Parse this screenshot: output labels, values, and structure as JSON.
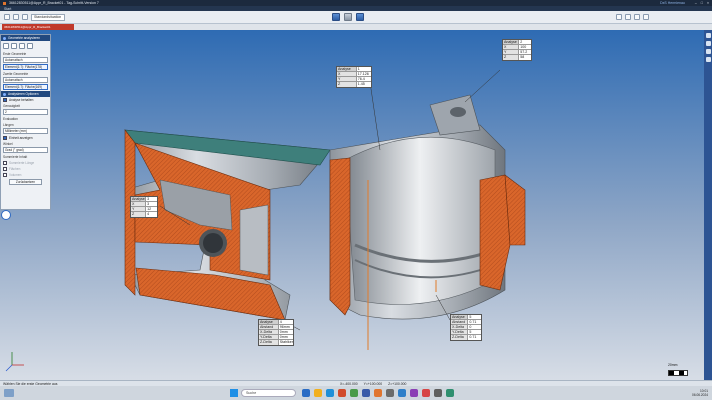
{
  "window": {
    "title": "36612830511@Appr_R_Bracket01 - Tag-Schritt-Version 7",
    "user": "DxS Hermienau",
    "controls": [
      "–",
      "□",
      "×"
    ]
  },
  "menu": {
    "label": "Start"
  },
  "toolbar": {
    "search_dropdown": "Standardsituation"
  },
  "document_tab": {
    "label": "36612830511@Appr_R_Bracket01"
  },
  "panel": {
    "header1": "Geometrie analysieren",
    "first_geometry_label": "Erste Geometrie",
    "first_geometry_mode": "Automatisch",
    "first_geometry_value": "Element(1:7): Fläche(178)",
    "second_geometry_label": "Zweite Geometrie",
    "second_geometry_mode": "Automatisch",
    "second_geometry_value": "Element(1:7): Fläche(169)",
    "header2": "Analysieren Optionen",
    "keep_analysis": "Analyse behalten",
    "precision_label": "Genauigkeit",
    "precision_value": "2",
    "evaluation_label": "Evaluation",
    "length_label": "Längen",
    "length_value": "Millimeter (mm)",
    "show_unit": "Einheit anzeigen",
    "angle_label": "Winkel",
    "angle_value": "Grad (° grad)",
    "sum_label": "Summierte Inhalt",
    "sum_length": "Summierte Länge",
    "sum_areas": "Flächen",
    "sum_volumes": "Volumen",
    "reset_button": "Zurücksetzen"
  },
  "annotations": {
    "top_center": {
      "rows": [
        {
          "k": "Analyse",
          "v": "1"
        },
        {
          "k": "X",
          "v": "17.126"
        },
        {
          "k": "Y",
          "v": "76.4"
        },
        {
          "k": "Z",
          "v": "1.45"
        }
      ]
    },
    "top_right": {
      "rows": [
        {
          "k": "Analyse",
          "v": "2"
        },
        {
          "k": "X",
          "v": "100"
        },
        {
          "k": "Y",
          "v": "57.2"
        },
        {
          "k": "Z",
          "v": "58"
        }
      ]
    },
    "left": {
      "rows": [
        {
          "k": "Analyse",
          "v": "3"
        },
        {
          "k": "X",
          "v": "3"
        },
        {
          "k": "Y",
          "v": "12"
        },
        {
          "k": "Z",
          "v": "4"
        }
      ]
    },
    "bottom_center": {
      "rows": [
        {
          "k": "Analyse",
          "v": "4"
        },
        {
          "k": "Abstand",
          "v": "96mm"
        },
        {
          "k": "X-Delta",
          "v": "0mm"
        },
        {
          "k": "Y-Delta",
          "v": "0mm"
        },
        {
          "k": "Z-Delta",
          "v": "Stahlkern"
        }
      ]
    },
    "bottom_right": {
      "rows": [
        {
          "k": "Analyse",
          "v": "5"
        },
        {
          "k": "Abstand",
          "v": "0.71"
        },
        {
          "k": "X-Delta",
          "v": "0"
        },
        {
          "k": "Y-Delta",
          "v": "5"
        },
        {
          "k": "Z-Delta",
          "v": "0.71"
        }
      ]
    }
  },
  "scale": {
    "label": "20mm"
  },
  "status": {
    "message": "Wählen Sie die erste Geometrie aus",
    "x": "X=-400.000",
    "y": "Y=+100.000",
    "z": "Z=+100.000"
  },
  "taskbar": {
    "search_placeholder": "Suche",
    "time": "10:01",
    "date": "06.06.2024"
  },
  "colors": {
    "section_cut": "#d9662b",
    "accent": "#22497f",
    "viewport_top": "#2e6bb3"
  }
}
